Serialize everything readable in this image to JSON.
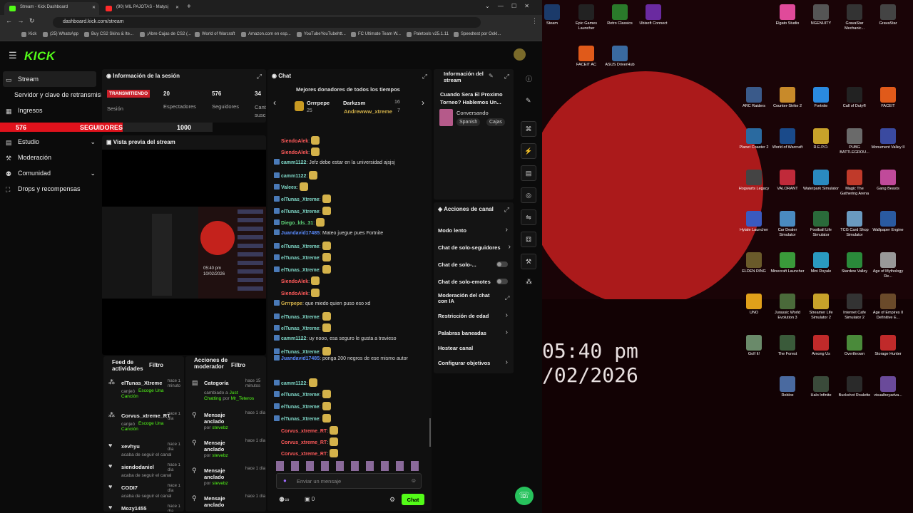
{
  "browser": {
    "tabs": [
      {
        "title": "Stream - Kick Dashboard",
        "close": "✕"
      },
      {
        "title": "(90) MIL PAJOTAS - Matysi̧",
        "close": "✕"
      }
    ],
    "new_tab": "+",
    "url": "dashboard.kick.com/stream",
    "bookmarks": [
      "Kick",
      "(25) WhatsApp",
      "Buy CS2 Skins & Ite...",
      "¡Abre Cajas de CS2 (...",
      "World of Warcraft",
      "Amazon.com en esp...",
      "YouTubeYouTubehtt...",
      "FC Ultimate Team W...",
      "Paletools v25.1.11",
      "Speedtest por Ookl..."
    ]
  },
  "kick": {
    "logo": "KICK"
  },
  "sidebar": {
    "items": [
      {
        "label": "Stream"
      },
      {
        "label": "Servidor y clave de retransmisión"
      },
      {
        "label": "Ingresos"
      },
      {
        "label": "Estudio"
      },
      {
        "label": "Moderación"
      },
      {
        "label": "Comunidad"
      },
      {
        "label": "Drops y recompensas"
      }
    ],
    "goal": {
      "current": "576",
      "label": "SEGUIDORES",
      "target": "1000",
      "progress": 0.576
    }
  },
  "session": {
    "title": "Información de la sesión",
    "status": "TRANSMITIENDO",
    "status_label": "Sesión",
    "viewers": "20",
    "viewers_label": "Espectadores",
    "followers": "576",
    "followers_label": "Seguidores",
    "third": "34",
    "third_label": "Cant. susc."
  },
  "preview": {
    "title": "Vista previa del stream",
    "clock": "05:40 pm",
    "date": "10/02/2026"
  },
  "feed": {
    "title": "Feed de actividades",
    "filter": "Filtro",
    "items": [
      {
        "user": "elTunas_Xtreme",
        "time": "hace 1 minuto",
        "action": "canjeó",
        "target": "Escoge Una Canción"
      },
      {
        "user": "Corvus_xtreme_RT",
        "time": "hace 1 día",
        "action": "canjeó",
        "target": "Escoge Una Canción"
      },
      {
        "user": "xevhyu",
        "time": "hace 1 día",
        "action": "acaba de seguir el canal",
        "target": ""
      },
      {
        "user": "siendodaniel",
        "time": "hace 1 día",
        "action": "acaba de seguir el canal",
        "target": ""
      },
      {
        "user": "CODI7",
        "time": "hace 1 día",
        "action": "acaba de seguir el canal",
        "target": ""
      },
      {
        "user": "Mozy1455",
        "time": "hace 1 día",
        "action": "",
        "target": ""
      }
    ]
  },
  "modactions": {
    "title": "Acciones de moderador",
    "filter": "Filtro",
    "items": [
      {
        "title": "Categoría",
        "time": "hace 15 minutos",
        "line1": "cambiado a",
        "hl1": "Just Chatting",
        "line2": "por",
        "hl2": "Mr_Teteros"
      },
      {
        "title": "Mensaje anclado",
        "time": "hace 1 día",
        "line1": "por",
        "hl1": "stevebz",
        "line2": "",
        "hl2": ""
      },
      {
        "title": "Mensaje anclado",
        "time": "hace 1 día",
        "line1": "por",
        "hl1": "stevebz",
        "line2": "",
        "hl2": ""
      },
      {
        "title": "Mensaje anclado",
        "time": "hace 1 día",
        "line1": "por",
        "hl1": "stevebz",
        "line2": "",
        "hl2": ""
      },
      {
        "title": "Mensaje anclado",
        "time": "hace 1 día",
        "line1": "",
        "hl1": "",
        "line2": "",
        "hl2": ""
      }
    ]
  },
  "chat": {
    "title": "Chat",
    "donors_title": "Mejores donadores de todos los tiempos",
    "donors": [
      {
        "name": "Grrrpepe",
        "amount": "25"
      },
      {
        "name": "Darkzsm",
        "amount": "16"
      },
      {
        "name": "Andrewww_xtreme",
        "amount": "7"
      }
    ],
    "messages": [
      {
        "user": "SiendoAlek",
        "color": "#ff5a5a",
        "text": ":",
        "emote": true
      },
      {
        "user": "SiendoAlek",
        "color": "#ff5a5a",
        "text": ":",
        "emote": true
      },
      {
        "user": "camm1122",
        "color": "#7fd8c8",
        "text": ": Jefz debe estar en la universidad ajsjsj",
        "emote": false
      },
      {
        "user": "camm1122",
        "color": "#7fd8c8",
        "text": ":",
        "emote": true
      },
      {
        "user": "Valeex",
        "color": "#7fd8c8",
        "text": ":",
        "emote": true
      },
      {
        "user": "elTunas_Xtreme",
        "color": "#7fd8c8",
        "text": ":",
        "emote": true
      },
      {
        "user": "elTunas_Xtreme",
        "color": "#7fd8c8",
        "text": ":",
        "emote": true
      },
      {
        "user": "Diego_lds_31",
        "color": "#5fd67a",
        "text": ":",
        "emote": true
      },
      {
        "user": "Juandavid17485",
        "color": "#5a8cff",
        "text": ": Mateo juegue pues Fortnite",
        "emote": false
      },
      {
        "user": "elTunas_Xtreme",
        "color": "#7fd8c8",
        "text": ":",
        "emote": true
      },
      {
        "user": "elTunas_Xtreme",
        "color": "#7fd8c8",
        "text": ":",
        "emote": true
      },
      {
        "user": "elTunas_Xtreme",
        "color": "#7fd8c8",
        "text": ":",
        "emote": true
      },
      {
        "user": "SiendoAlek",
        "color": "#ff5a5a",
        "text": ":",
        "emote": true
      },
      {
        "user": "SiendoAlek",
        "color": "#ff5a5a",
        "text": ":",
        "emote": true
      },
      {
        "user": "Grrrpepe",
        "color": "#d4b24a",
        "text": ": que miedo quien puso eso xd",
        "emote": false
      },
      {
        "user": "elTunas_Xtreme",
        "color": "#7fd8c8",
        "text": ":",
        "emote": true
      },
      {
        "user": "elTunas_Xtreme",
        "color": "#7fd8c8",
        "text": ":",
        "emote": true
      },
      {
        "user": "camm1122",
        "color": "#7fd8c8",
        "text": ": uy nooo, esa seguro le gusta a travieso",
        "emote": false
      },
      {
        "user": "elTunas_Xtreme",
        "color": "#7fd8c8",
        "text": ":",
        "emote": true
      },
      {
        "user": "Juandavid17485",
        "color": "#5a8cff",
        "text": ": ponga 200 negros de ese mismo autor",
        "emote": false
      },
      {
        "user": "camm1122",
        "color": "#7fd8c8",
        "text": ":",
        "emote": true
      },
      {
        "user": "elTunas_Xtreme",
        "color": "#7fd8c8",
        "text": ":",
        "emote": true
      },
      {
        "user": "elTunas_Xtreme",
        "color": "#7fd8c8",
        "text": ":",
        "emote": true
      },
      {
        "user": "elTunas_Xtreme",
        "color": "#7fd8c8",
        "text": ":",
        "emote": true
      },
      {
        "user": "Corvus_xtreme_RT",
        "color": "#ff5a5a",
        "text": ":",
        "emote": true
      },
      {
        "user": "Corvus_xtreme_RT",
        "color": "#ff5a5a",
        "text": ":",
        "emote": true
      },
      {
        "user": "Corvus_xtreme_RT",
        "color": "#ff5a5a",
        "text": ":",
        "emote": true
      }
    ],
    "input_placeholder": "Enviar un mensaje",
    "points": "0",
    "send": "Chat"
  },
  "stream_info": {
    "title": "Información del stream",
    "stream_title": "Cuando Sera El Proximo Torneo? Hablemos Un...",
    "category": "Conversando",
    "tags": [
      "Spanish",
      "Cajas"
    ]
  },
  "channel_actions": {
    "title": "Acciones de canal",
    "items": [
      "Modo lento",
      "Chat de solo-seguidores",
      "Chat de solo-...",
      "Chat de solo-emotes",
      "Moderación del chat con IA",
      "Restricción de edad",
      "Palabras baneadas",
      "Hostear canal",
      "Configurar objetivos"
    ]
  },
  "desktop": {
    "icons": [
      "Steam",
      "Epic Games Launcher",
      "Retro Classics",
      "Ubisoft Connect",
      "FACEIT AC",
      "ASUS DriverHub",
      "Elgato Studio",
      "NGENUITY",
      "GravaStar Mechanic...",
      "GravaStar",
      "ARC Raiders",
      "Counter-Strike 2",
      "Fortnite",
      "Call of Duty®",
      "FACEIT",
      "Planet Coaster 2",
      "World of Warcraft",
      "R.E.P.O.",
      "PUBG BATTLEGROU...",
      "Monument Valley II",
      "Hogwarts Legacy",
      "VALORANT",
      "Waterpark Simulator",
      "Magic The Gathering Arena",
      "Gang Beasts",
      "Hytale Launcher",
      "Car Dealer Simulator",
      "Football Life Simulator",
      "TCG Card Shop Simulator",
      "Wallpaper Engine",
      "ELDEN RING",
      "Minecraft Launcher",
      "Mini Royale",
      "Stardew Valley",
      "Age of Mythology Re...",
      "UNO",
      "Jurassic World Evolution 3",
      "Streamer Life Simulator 2",
      "Internet Cafe Simulator 2",
      "Age of Empires II Definitive E...",
      "Golf It!",
      "The Forest",
      "Among Us",
      "Overthrown",
      "Storage Hunter",
      "Roblox",
      "Halo Infinite",
      "Buckshot Roulette",
      "visualboyadva..."
    ],
    "clock": "05:40 pm",
    "date": "/02/2026"
  }
}
